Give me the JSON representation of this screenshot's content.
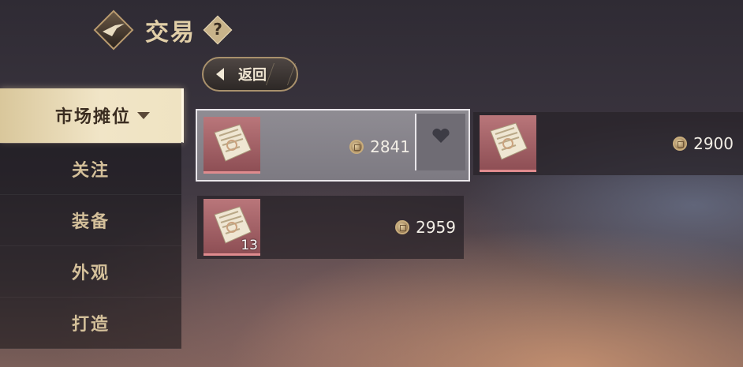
{
  "header": {
    "title": "交易",
    "help_symbol": "?",
    "logo_icon": "trade-logo-icon"
  },
  "back_button": {
    "label": "返回"
  },
  "sidebar": {
    "items": [
      {
        "label": "市场摊位",
        "active": true
      },
      {
        "label": "关注",
        "active": false
      },
      {
        "label": "装备",
        "active": false
      },
      {
        "label": "外观",
        "active": false
      },
      {
        "label": "打造",
        "active": false
      }
    ]
  },
  "listings": [
    {
      "price": "2841",
      "quantity": "",
      "selected": true,
      "icon": "scroll-document-icon"
    },
    {
      "price": "2900",
      "quantity": "",
      "selected": false,
      "icon": "scroll-document-icon"
    },
    {
      "price": "2959",
      "quantity": "13",
      "selected": false,
      "icon": "scroll-document-icon"
    }
  ],
  "colors": {
    "accent_gold": "#d4c09a",
    "item_rarity": "#b9767a",
    "active_tab": "#efe3c2"
  }
}
